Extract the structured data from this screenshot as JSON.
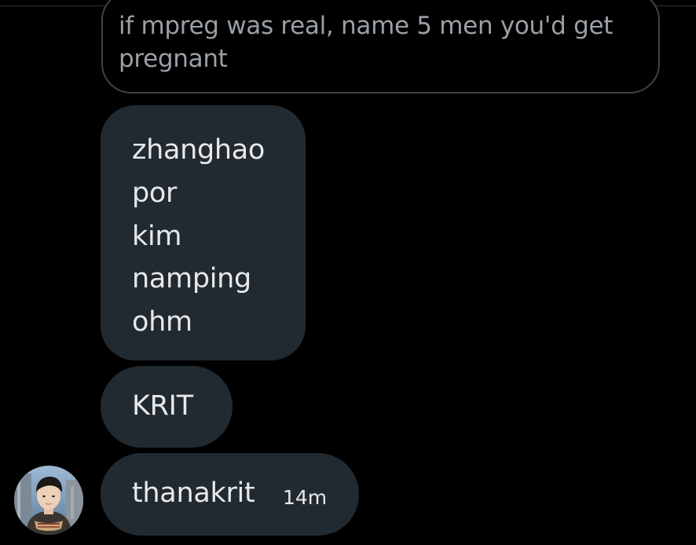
{
  "quoted_message": {
    "text": "if mpreg was real, name 5 men you'd get pregnant"
  },
  "messages": [
    {
      "lines": [
        "zhanghao",
        "por",
        "kim",
        "namping",
        "ohm"
      ]
    },
    {
      "text": "KRIT"
    },
    {
      "text": "thanakrit",
      "time": "14m"
    }
  ],
  "sender": {
    "avatar_icon": "profile-photo"
  },
  "colors": {
    "background": "#000000",
    "bubble": "#222a31",
    "bubble_text": "#e7e9ea",
    "quoted_text": "#9aa0a6",
    "quoted_border": "#3e4347"
  }
}
